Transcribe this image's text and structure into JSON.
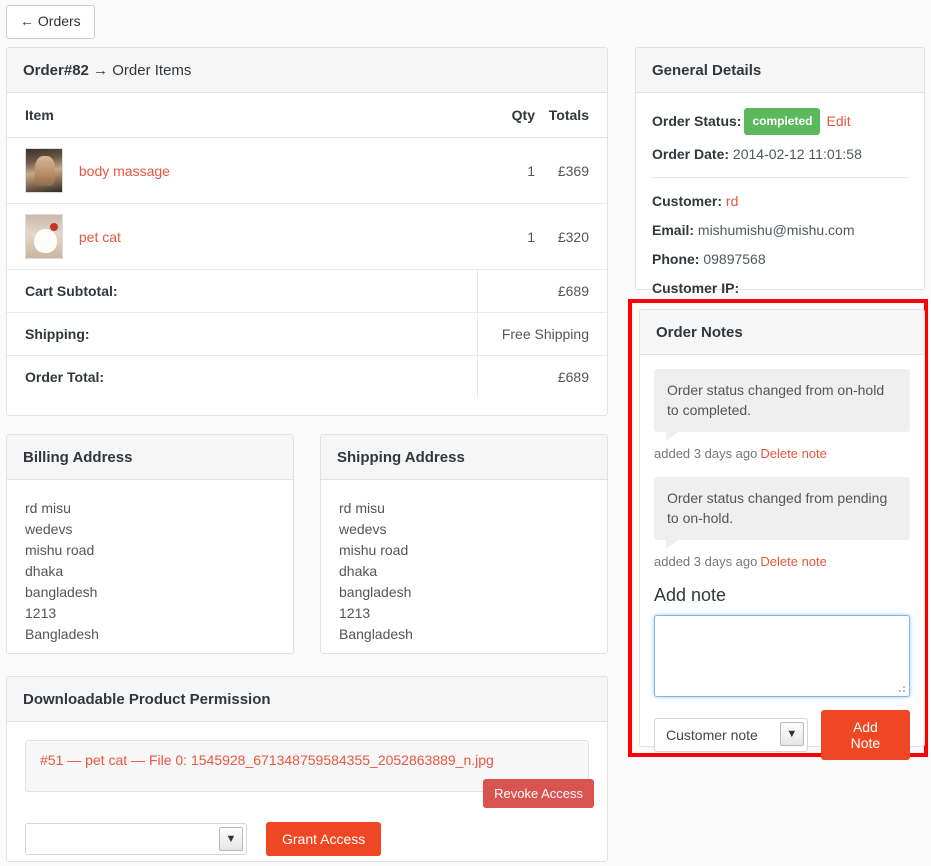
{
  "back_button": {
    "label": "← Orders"
  },
  "order_items": {
    "title_order": "Order#82",
    "title_arrow": "→",
    "title_suffix": "Order Items",
    "columns": {
      "item": "Item",
      "qty": "Qty",
      "totals": "Totals"
    },
    "rows": [
      {
        "name": "body massage",
        "qty": "1",
        "total": "£369",
        "thumb": "product-thumbnail-body-massage"
      },
      {
        "name": "pet cat",
        "qty": "1",
        "total": "£320",
        "thumb": "product-thumbnail-pet-cat"
      }
    ],
    "totals": [
      {
        "label": "Cart Subtotal:",
        "value": "£689"
      },
      {
        "label": "Shipping:",
        "value": "Free Shipping"
      },
      {
        "label": "Order Total:",
        "value": "£689"
      }
    ]
  },
  "billing": {
    "title": "Billing Address",
    "lines": [
      "rd misu",
      "wedevs",
      "mishu road",
      "dhaka",
      "bangladesh",
      "1213",
      "Bangladesh"
    ]
  },
  "shipping": {
    "title": "Shipping Address",
    "lines": [
      "rd misu",
      "wedevs",
      "mishu road",
      "dhaka",
      "bangladesh",
      "1213",
      "Bangladesh"
    ]
  },
  "downloadable": {
    "title": "Downloadable Product Permission",
    "file_label": "#51 — pet cat — File 0: 1545928_671348759584355_2052863889_n.jpg",
    "revoke_label": "Revoke Access",
    "select_value": "",
    "select_arrow": "▼",
    "grant_label": "Grant Access"
  },
  "general": {
    "title": "General Details",
    "order_status_label": "Order Status:",
    "order_status_value": "completed",
    "edit_label": "Edit",
    "order_date_label": "Order Date:",
    "order_date_value": "2014-02-12 11:01:58",
    "customer_label": "Customer:",
    "customer_value": "rd",
    "email_label": "Email:",
    "email_value": "mishumishu@mishu.com",
    "phone_label": "Phone:",
    "phone_value": "09897568",
    "customer_ip_label": "Customer IP:",
    "customer_ip_value": ""
  },
  "notes": {
    "title": "Order Notes",
    "items": [
      {
        "text": "Order status changed from on-hold to completed.",
        "meta": "added 3 days ago",
        "delete_label": "Delete note"
      },
      {
        "text": "Order status changed from pending to on-hold.",
        "meta": "added 3 days ago",
        "delete_label": "Delete note"
      }
    ],
    "add_note_title": "Add note",
    "textarea_value": "",
    "note_type_value": "Customer note",
    "select_arrow": "▼",
    "add_note_label": "Add Note"
  },
  "colors": {
    "accent_link": "#e8563f",
    "button_orange": "#ef4723",
    "status_green": "#5cb85c",
    "revoke_red": "#d9534f",
    "highlight_red": "#ff0000"
  }
}
